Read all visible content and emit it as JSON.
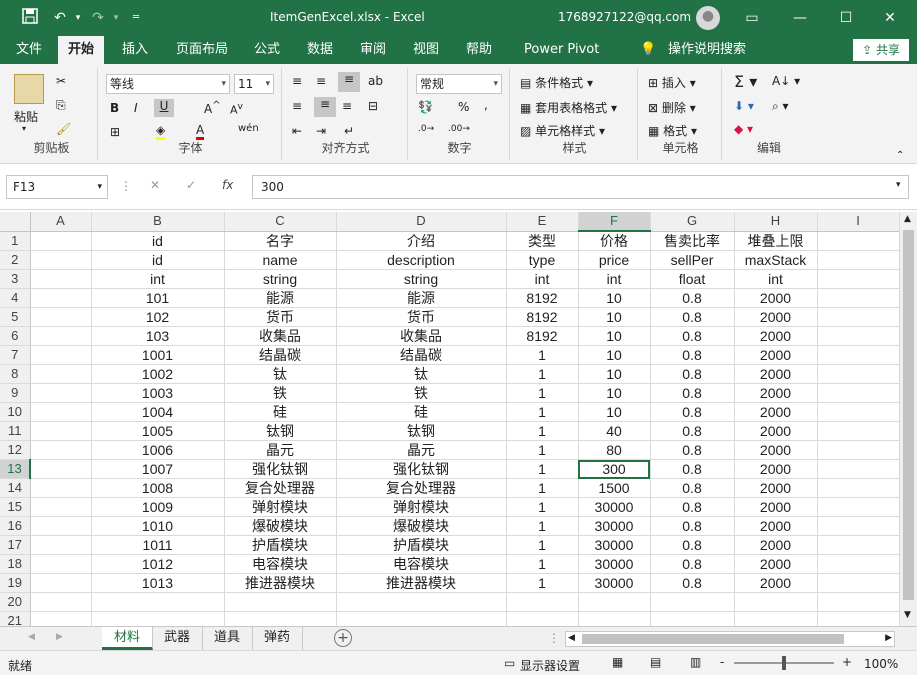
{
  "window": {
    "title": "ItemGenExcel.xlsx  -  Excel",
    "account": "1768927122@qq.com"
  },
  "menu_tabs": [
    "文件",
    "开始",
    "插入",
    "页面布局",
    "公式",
    "数据",
    "审阅",
    "视图",
    "帮助",
    "Power Pivot"
  ],
  "active_tab": "开始",
  "tell_me": "操作说明搜索",
  "share_label": "共享",
  "ribbon": {
    "clipboard": {
      "paste": "粘贴",
      "label": "剪贴板"
    },
    "font": {
      "name": "等线",
      "size": "11",
      "label": "字体",
      "bold": "B",
      "italic": "I",
      "underline": "U",
      "wen": "wén"
    },
    "alignment": {
      "label": "对齐方式"
    },
    "number": {
      "format": "常规",
      "label": "数字",
      "percent": "%"
    },
    "styles": {
      "conditional": "条件格式",
      "table": "套用表格格式",
      "cell": "单元格样式",
      "label": "样式"
    },
    "cells": {
      "insert": "插入",
      "delete": "删除",
      "format": "格式",
      "label": "单元格"
    },
    "editing": {
      "label": "编辑"
    }
  },
  "formula_bar": {
    "name_box": "F13",
    "content": "300",
    "fx": "fx"
  },
  "columns": [
    "A",
    "B",
    "C",
    "D",
    "E",
    "F",
    "G",
    "H",
    "I"
  ],
  "rows": [
    [
      "",
      "id",
      "名字",
      "介绍",
      "类型",
      "价格",
      "售卖比率",
      "堆叠上限",
      ""
    ],
    [
      "",
      "id",
      "name",
      "description",
      "type",
      "price",
      "sellPer",
      "maxStack",
      ""
    ],
    [
      "",
      "int",
      "string",
      "string",
      "int",
      "int",
      "float",
      "int",
      ""
    ],
    [
      "",
      "101",
      "能源",
      "能源",
      "8192",
      "10",
      "0.8",
      "2000",
      ""
    ],
    [
      "",
      "102",
      "货币",
      "货币",
      "8192",
      "10",
      "0.8",
      "2000",
      ""
    ],
    [
      "",
      "103",
      "收集品",
      "收集品",
      "8192",
      "10",
      "0.8",
      "2000",
      ""
    ],
    [
      "",
      "1001",
      "结晶碳",
      "结晶碳",
      "1",
      "10",
      "0.8",
      "2000",
      ""
    ],
    [
      "",
      "1002",
      "钛",
      "钛",
      "1",
      "10",
      "0.8",
      "2000",
      ""
    ],
    [
      "",
      "1003",
      "铁",
      "铁",
      "1",
      "10",
      "0.8",
      "2000",
      ""
    ],
    [
      "",
      "1004",
      "硅",
      "硅",
      "1",
      "10",
      "0.8",
      "2000",
      ""
    ],
    [
      "",
      "1005",
      "钛钢",
      "钛钢",
      "1",
      "40",
      "0.8",
      "2000",
      ""
    ],
    [
      "",
      "1006",
      "晶元",
      "晶元",
      "1",
      "80",
      "0.8",
      "2000",
      ""
    ],
    [
      "",
      "1007",
      "强化钛钢",
      "强化钛钢",
      "1",
      "300",
      "0.8",
      "2000",
      ""
    ],
    [
      "",
      "1008",
      "复合处理器",
      "复合处理器",
      "1",
      "1500",
      "0.8",
      "2000",
      ""
    ],
    [
      "",
      "1009",
      "弹射模块",
      "弹射模块",
      "1",
      "30000",
      "0.8",
      "2000",
      ""
    ],
    [
      "",
      "1010",
      "爆破模块",
      "爆破模块",
      "1",
      "30000",
      "0.8",
      "2000",
      ""
    ],
    [
      "",
      "1011",
      "护盾模块",
      "护盾模块",
      "1",
      "30000",
      "0.8",
      "2000",
      ""
    ],
    [
      "",
      "1012",
      "电容模块",
      "电容模块",
      "1",
      "30000",
      "0.8",
      "2000",
      ""
    ],
    [
      "",
      "1013",
      "推进器模块",
      "推进器模块",
      "1",
      "30000",
      "0.8",
      "2000",
      ""
    ],
    [
      "",
      "",
      "",
      "",
      "",
      "",
      "",
      "",
      ""
    ],
    [
      "",
      "",
      "",
      "",
      "",
      "",
      "",
      "",
      ""
    ]
  ],
  "sheets": [
    "材料",
    "武器",
    "道具",
    "弹药"
  ],
  "active_sheet": "材料",
  "status": {
    "ready": "就绪",
    "display_settings": "显示器设置",
    "zoom": "100%",
    "minus": "-",
    "plus": "+"
  },
  "colors": {
    "accent": "#217346"
  }
}
